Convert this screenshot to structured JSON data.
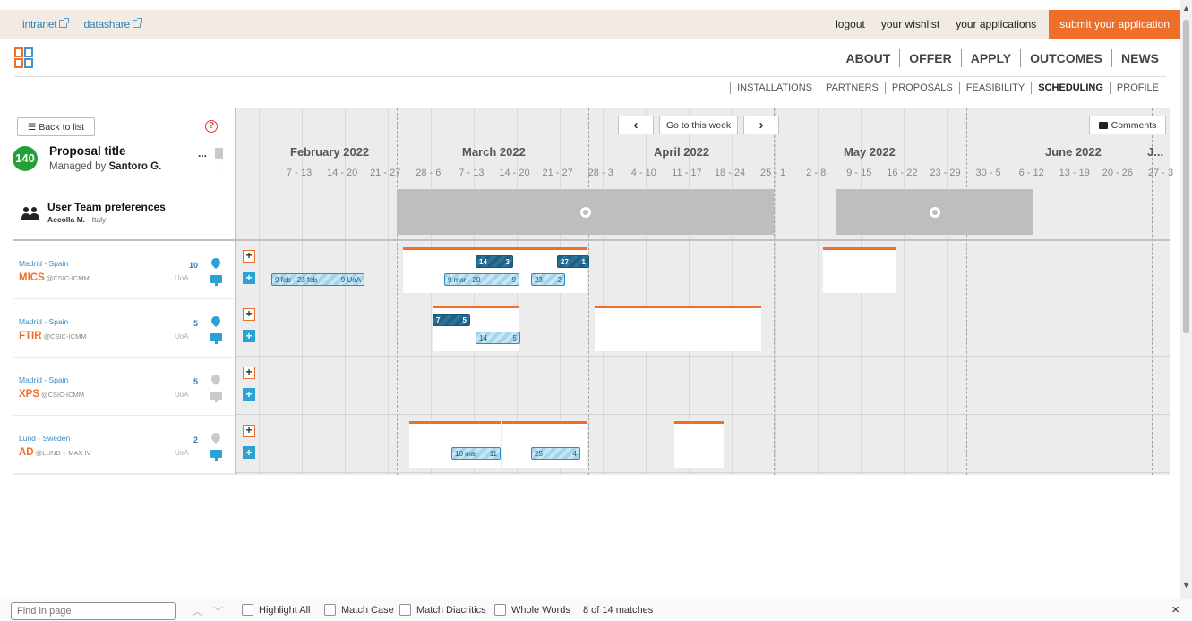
{
  "topbar": {
    "links": [
      "intranet",
      "datashare"
    ],
    "logout": "logout",
    "wishlist": "your wishlist",
    "applications": "your applications",
    "submit": "submit your application"
  },
  "mainnav": [
    "ABOUT",
    "OFFER",
    "APPLY",
    "OUTCOMES",
    "NEWS"
  ],
  "subnav": [
    "INSTALLATIONS",
    "PARTNERS",
    "PROPOSALS",
    "FEASIBILITY",
    "SCHEDULING",
    "PROFILE"
  ],
  "subnav_active": "SCHEDULING",
  "scheduler": {
    "back_label": "Back to list",
    "help": "?",
    "proposal_number": "140",
    "proposal_title": "Proposal title",
    "managed_by_prefix": "Managed by",
    "manager": "Santoro G.",
    "ellipsis": "...",
    "team_title": "User Team preferences",
    "team_member": "Accolla M.",
    "team_country": "- Italy",
    "prev": "‹",
    "this_week": "Go to this week",
    "next": "›",
    "comments": "Comments",
    "months": [
      "February 2022",
      "March 2022",
      "April 2022",
      "May 2022",
      "June 2022",
      "J..."
    ],
    "weeks": [
      "7 - 13",
      "14 - 20",
      "21 - 27",
      "28 - 6",
      "7 - 13",
      "14 - 20",
      "21 - 27",
      "28 - 3",
      "4 - 10",
      "11 - 17",
      "18 - 24",
      "25 - 1",
      "2 - 8",
      "9 - 15",
      "16 - 22",
      "23 - 29",
      "30 - 5",
      "6 - 12",
      "13 - 19",
      "20 - 26",
      "27 - 3"
    ],
    "plus": "+",
    "rows": [
      {
        "location": "Madrid - Spain",
        "name": "MICS",
        "org": "@CSIC-ICMM",
        "count": "10",
        "uoa": "UoA",
        "active": true,
        "bookings": [
          {
            "left": "9 feb - 23 feb",
            "right": "9 UoA"
          },
          {
            "left": "14",
            "right": "3"
          },
          {
            "left": "27",
            "right": "1"
          },
          {
            "left": "9 mar - 20",
            "right": "9"
          },
          {
            "left": "23",
            "right": "2"
          }
        ]
      },
      {
        "location": "Madrid - Spain",
        "name": "FTIR",
        "org": "@CSIC-ICMM",
        "count": "5",
        "uoa": "UoA",
        "active": true,
        "bookings": [
          {
            "left": "7",
            "right": "5"
          },
          {
            "left": "14",
            "right": "5"
          }
        ]
      },
      {
        "location": "Madrid - Spain",
        "name": "XPS",
        "org": "@CSIC-ICMM",
        "count": "5",
        "uoa": "UoA",
        "active": false,
        "bookings": []
      },
      {
        "location": "Lund - Sweden",
        "name": "AD",
        "org": "@LUND + MAX IV",
        "count": "2",
        "uoa": "UoA",
        "active": false,
        "bookings": [
          {
            "left": "10 mar",
            "right": "11"
          },
          {
            "left": "25",
            "right": "4"
          }
        ]
      }
    ]
  },
  "findbar": {
    "placeholder": "Find in page",
    "highlight_all": "Highlight All",
    "match_case": "Match Case",
    "match_diacritics": "Match Diacritics",
    "whole_words": "Whole Words",
    "matches": "8 of 14 matches",
    "close": "×"
  },
  "colors": {
    "accent": "#ed6f2a",
    "badge": "#23a139",
    "link": "#2e7fb8",
    "booking": "#a4d4ea",
    "booking_dark": "#1f6183"
  }
}
